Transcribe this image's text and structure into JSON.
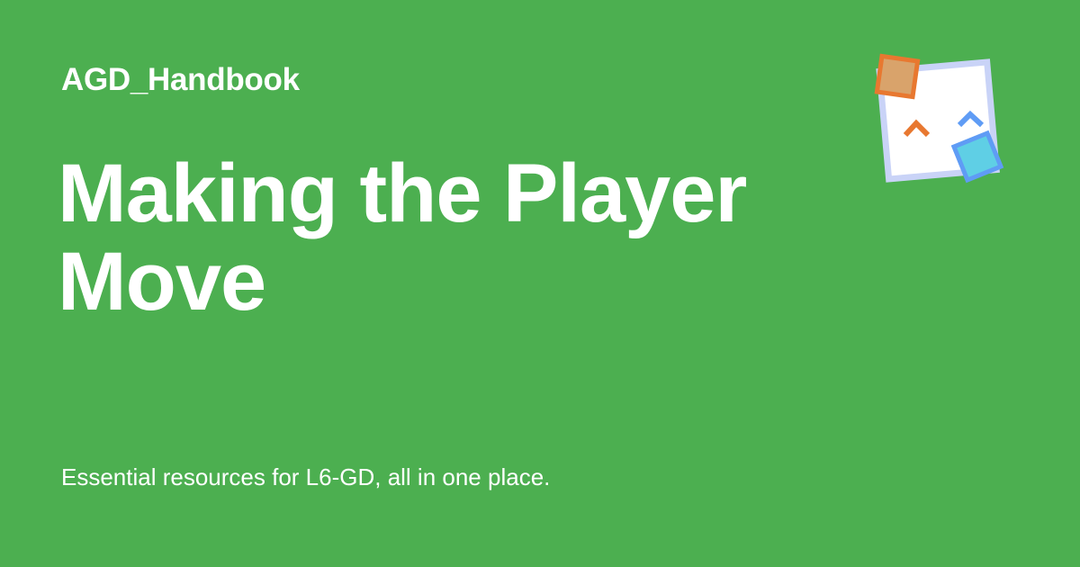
{
  "site": {
    "name": "AGD_Handbook"
  },
  "page": {
    "title": "Making the Player Move",
    "tagline": "Essential resources for L6-GD, all in one place."
  },
  "colors": {
    "background": "#4caf50",
    "text": "#ffffff",
    "logo_card_fill": "#ffffff",
    "logo_card_border": "#c9d3f7",
    "logo_orange": "#e87830",
    "logo_orange_fill": "#d9a36b",
    "logo_blue": "#5f9cf5",
    "logo_cyan_fill": "#5fcfe5"
  },
  "icons": {
    "logo": "game-sprites-card-icon",
    "orange_arrow": "orange-chevron-up-icon",
    "blue_arrow": "blue-chevron-up-icon"
  }
}
